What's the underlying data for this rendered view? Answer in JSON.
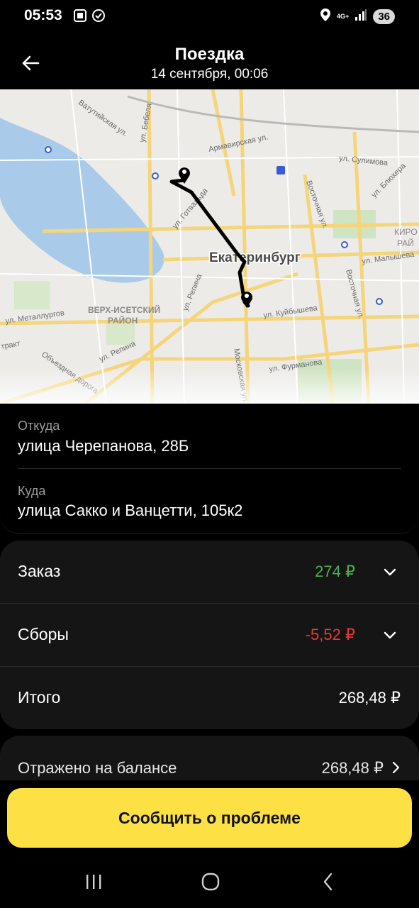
{
  "status_bar": {
    "time": "05:53",
    "network": "4G+",
    "battery": "36"
  },
  "header": {
    "title": "Поездка",
    "subtitle": "14 сентября, 00:06",
    "back_icon": "arrow-left-icon"
  },
  "map": {
    "city_label": "Екатеринбург",
    "streets": [
      "ул. Бебеля",
      "Ватутийская ул.",
      "Армавирская ул.",
      "ул. Сулимова",
      "ул. Блюхера",
      "Восточная ул.",
      "ул. Готвальда",
      "ул. Малышева",
      "ул. Репина",
      "ВЕРХ-ИСЕТСКИЙ",
      "РАЙОН",
      "ул. Металлургов",
      "ул. Куйбышева",
      "Восточная ул.",
      "тракт",
      "ул. Репина",
      "Объездная дорога",
      "Московская ул.",
      "ул. Фурманова",
      "КИРО",
      "РАЙ"
    ]
  },
  "route": {
    "from_label": "Откуда",
    "from_value": "улица Черепанова, 28Б",
    "to_label": "Куда",
    "to_value": "улица Сакко и Ванцетти, 105к2"
  },
  "price": {
    "order_label": "Заказ",
    "order_amount": "274 ₽",
    "order_color": "#4caf50",
    "fees_label": "Сборы",
    "fees_amount": "-5,52 ₽",
    "fees_color": "#e53935",
    "total_label": "Итого",
    "total_amount": "268,48 ₽"
  },
  "balance": {
    "label": "Отражено на балансе",
    "amount": "268,48 ₽"
  },
  "report_button": "Сообщить о проблеме",
  "accent_color": "#fce044"
}
